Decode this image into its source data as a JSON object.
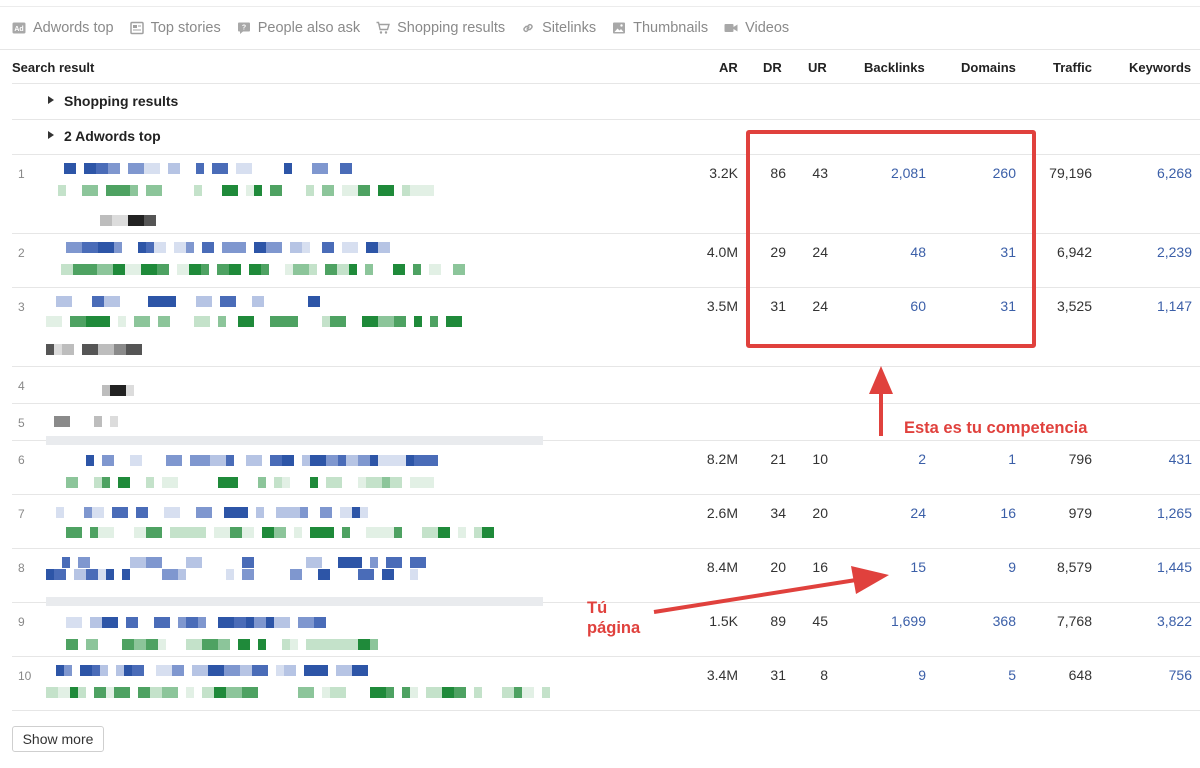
{
  "filters": [
    {
      "label": "Adwords top",
      "icon": "ad-badge-icon"
    },
    {
      "label": "Top stories",
      "icon": "news-icon"
    },
    {
      "label": "People also ask",
      "icon": "question-bubble-icon"
    },
    {
      "label": "Shopping results",
      "icon": "cart-icon"
    },
    {
      "label": "Sitelinks",
      "icon": "link-icon"
    },
    {
      "label": "Thumbnails",
      "icon": "image-icon"
    },
    {
      "label": "Videos",
      "icon": "video-icon"
    }
  ],
  "table": {
    "headers": {
      "search_result": "Search result",
      "ar": "AR",
      "dr": "DR",
      "ur": "UR",
      "backlinks": "Backlinks",
      "domains": "Domains",
      "traffic": "Traffic",
      "keywords": "Keywords"
    },
    "groups": {
      "shopping": "Shopping results",
      "adwords": "2 Adwords top"
    },
    "rows": [
      {
        "pos": "1",
        "ar": "3.2K",
        "dr": "86",
        "ur": "43",
        "backlinks": "2,081",
        "domains": "260",
        "traffic": "79,196",
        "keywords": "6,268"
      },
      {
        "pos": "2",
        "ar": "4.0M",
        "dr": "29",
        "ur": "24",
        "backlinks": "48",
        "domains": "31",
        "traffic": "6,942",
        "keywords": "2,239"
      },
      {
        "pos": "3",
        "ar": "3.5M",
        "dr": "31",
        "ur": "24",
        "backlinks": "60",
        "domains": "31",
        "traffic": "3,525",
        "keywords": "1,147"
      },
      {
        "pos": "4"
      },
      {
        "pos": "5"
      },
      {
        "pos": "6",
        "ar": "8.2M",
        "dr": "21",
        "ur": "10",
        "backlinks": "2",
        "domains": "1",
        "traffic": "796",
        "keywords": "431"
      },
      {
        "pos": "7",
        "ar": "2.6M",
        "dr": "34",
        "ur": "20",
        "backlinks": "24",
        "domains": "16",
        "traffic": "979",
        "keywords": "1,265"
      },
      {
        "pos": "8",
        "ar": "8.4M",
        "dr": "20",
        "ur": "16",
        "backlinks": "15",
        "domains": "9",
        "traffic": "8,579",
        "keywords": "1,445"
      },
      {
        "pos": "9",
        "ar": "1.5K",
        "dr": "89",
        "ur": "45",
        "backlinks": "1,699",
        "domains": "368",
        "traffic": "7,768",
        "keywords": "3,822"
      },
      {
        "pos": "10",
        "ar": "3.4M",
        "dr": "31",
        "ur": "8",
        "backlinks": "9",
        "domains": "5",
        "traffic": "648",
        "keywords": "756"
      }
    ]
  },
  "show_more": "Show more",
  "annotations": {
    "competition": "Esta es tu competencia",
    "your_page_line1": "Tú",
    "your_page_line2": "página"
  },
  "colors": {
    "annotation_red": "#e0413d",
    "link_blue": "#3b5fa8"
  }
}
